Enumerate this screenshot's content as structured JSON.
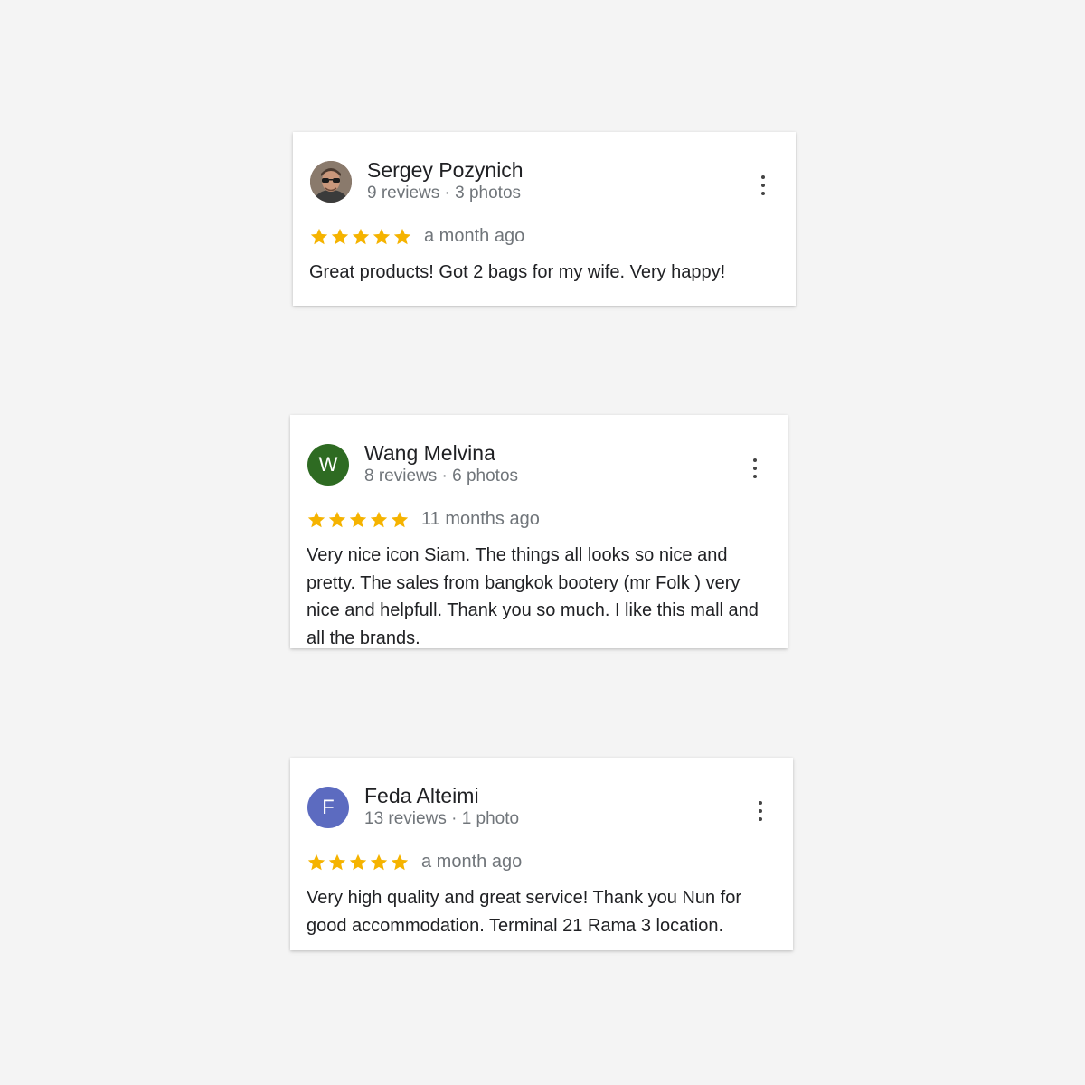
{
  "colors": {
    "page_background": "#f4f4f4",
    "star": "#f5b300",
    "meta_text": "#70757a"
  },
  "reviews": [
    {
      "name": "Sergey Pozynich",
      "meta": "9 reviews · 3 photos",
      "avatar_letter": "",
      "avatar_type": "photo",
      "rating": 5,
      "time": "a month ago",
      "text": "Great products! Got 2 bags for my wife. Very happy!"
    },
    {
      "name": "Wang Melvina",
      "meta": "8 reviews · 6 photos",
      "avatar_letter": "W",
      "avatar_color": "#2e6b22",
      "rating": 5,
      "time": "11 months ago",
      "text": "Very nice icon Siam. The things all looks so nice and pretty. The sales from bangkok bootery (mr Folk ) very nice and helpfull. Thank you so much. I like this mall and all the brands."
    },
    {
      "name": "Feda Alteimi",
      "meta": "13 reviews · 1 photo",
      "avatar_letter": "F",
      "avatar_color": "#5c6bc0",
      "rating": 5,
      "time": "a month ago",
      "text": "Very high quality and great service! Thank you Nun for good accommodation. Terminal 21 Rama 3 location."
    }
  ]
}
